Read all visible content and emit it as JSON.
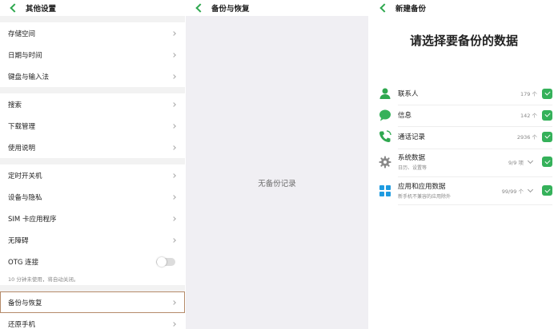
{
  "panel1": {
    "title": "其他设置",
    "items": [
      {
        "label": "存储空间"
      },
      {
        "label": "日期与时间"
      },
      {
        "label": "键盘与输入法"
      },
      {
        "label": "搜索"
      },
      {
        "label": "下载管理"
      },
      {
        "label": "使用说明"
      },
      {
        "label": "定时开关机"
      },
      {
        "label": "设备与隐私"
      },
      {
        "label": "SIM 卡应用程序"
      },
      {
        "label": "无障碍"
      },
      {
        "label": "OTG 连接"
      },
      {
        "label": "备份与恢复"
      },
      {
        "label": "还原手机"
      }
    ],
    "otg_note": "10 分钟未使用，将自动关闭。",
    "otg_enabled": false
  },
  "panel2": {
    "title": "备份与恢复",
    "empty_text": "无备份记录"
  },
  "panel3": {
    "title": "新建备份",
    "heading": "请选择要备份的数据",
    "items": [
      {
        "name": "联系人",
        "sub": "",
        "count": "179 个",
        "checked": true,
        "icon": "person-icon"
      },
      {
        "name": "信息",
        "sub": "",
        "count": "142 个",
        "checked": true,
        "icon": "message-icon"
      },
      {
        "name": "通话记录",
        "sub": "",
        "count": "2936 个",
        "checked": true,
        "icon": "phone-icon"
      },
      {
        "name": "系统数据",
        "sub": "日历、设置等",
        "count": "9/9 项",
        "checked": true,
        "icon": "gear-icon"
      },
      {
        "name": "应用和应用数据",
        "sub": "新手机不兼容的应用除外",
        "count": "99/99 个",
        "checked": true,
        "icon": "apps-icon"
      }
    ]
  },
  "colors": {
    "accent": "#2fa84f",
    "check": "#35b15a",
    "selection_outline": "#b58b6a"
  }
}
